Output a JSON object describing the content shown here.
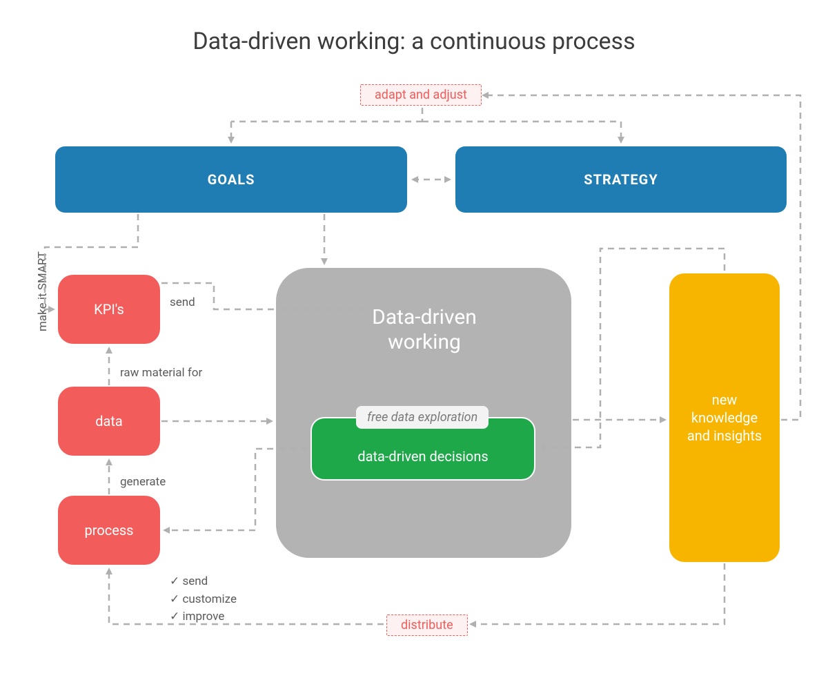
{
  "title": "Data-driven working: a continuous process",
  "adapt": "adapt and adjust",
  "goals": "GOALS",
  "strategy": "STRATEGY",
  "make_smart": "make it SMART",
  "kpis": "KPI's",
  "send": "send",
  "raw_material": "raw material for",
  "data": "data",
  "generate": "generate",
  "process": "process",
  "big_title": "Data-driven working",
  "free_explore": "free data exploration",
  "ddd": "data-driven decisions",
  "new_knowledge": "new knowledge and insights",
  "distribute": "distribute",
  "checks": {
    "a": "send",
    "b": "customize",
    "c": "improve"
  }
}
